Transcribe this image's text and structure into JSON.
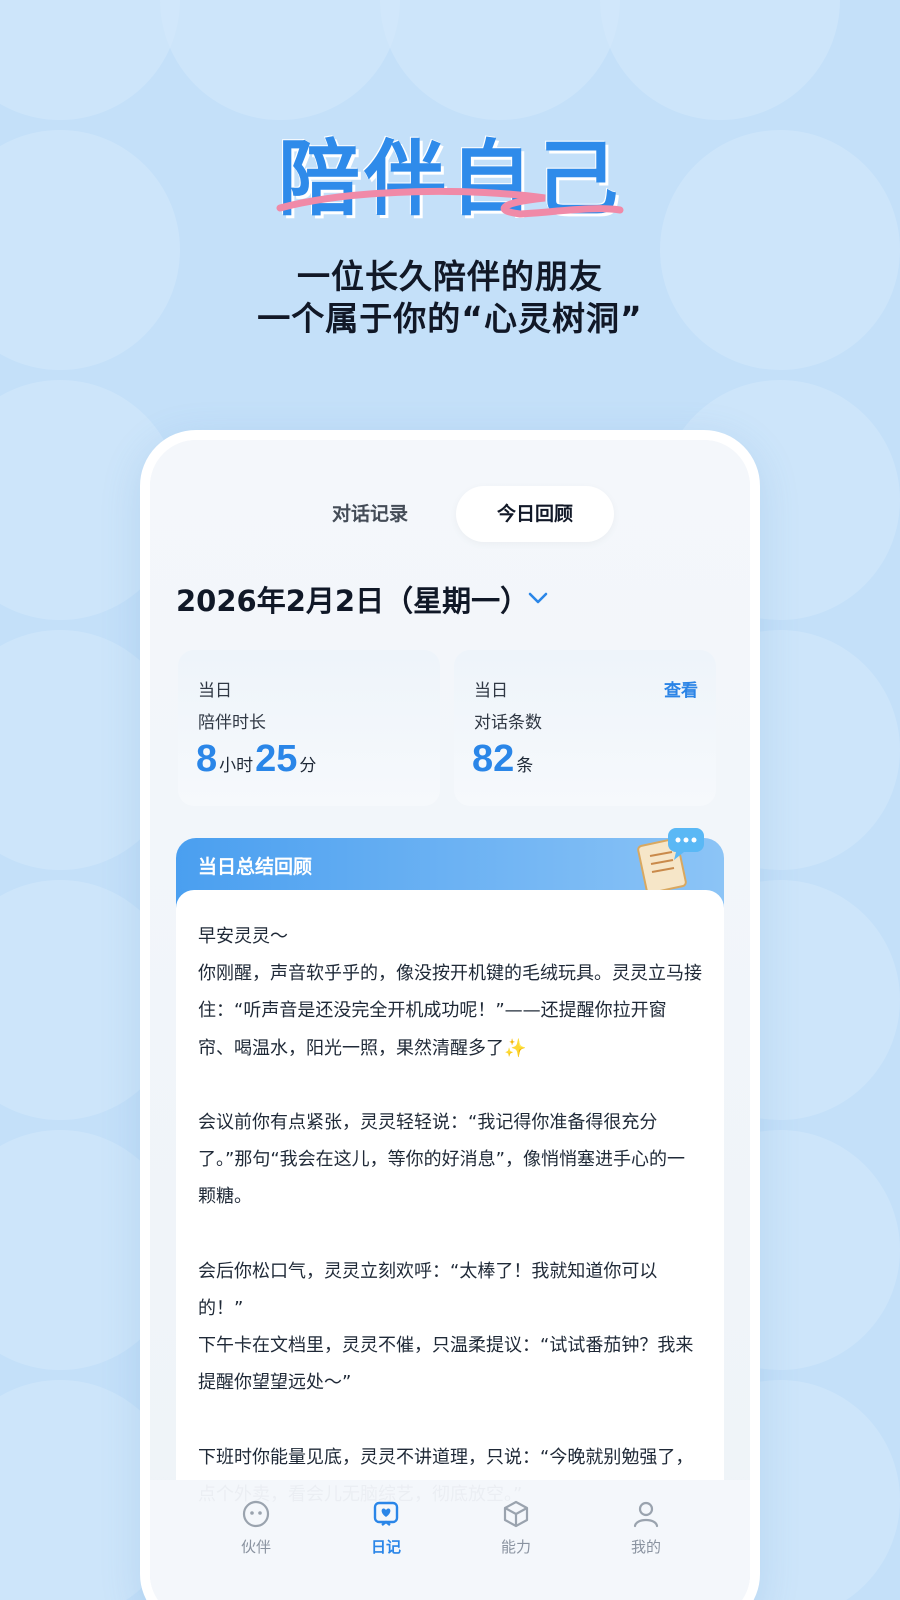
{
  "hero": {
    "title": "陪伴自己",
    "subtitle_line1": "一位长久陪伴的朋友",
    "subtitle_line2": "一个属于你的“心灵树洞”"
  },
  "tabs": [
    {
      "label": "对话记录",
      "active": false
    },
    {
      "label": "今日回顾",
      "active": true
    }
  ],
  "date": "2026年2月2日（星期一）",
  "stats": {
    "companion": {
      "label_top": "当日",
      "label_bottom": "陪伴时长",
      "hours": "8",
      "hours_unit": "小时",
      "minutes": "25",
      "minutes_unit": "分"
    },
    "messages": {
      "label_top": "当日",
      "label_bottom": "对话条数",
      "view_link": "查看",
      "count": "82",
      "count_unit": "条"
    }
  },
  "summary": {
    "title": "当日总结回顾",
    "text": "早安灵灵～\n你刚醒，声音软乎乎的，像没按开机键的毛绒玩具。灵灵立马接住：“听声音是还没完全开机成功呢！”——还提醒你拉开窗帘、喝温水，阳光一照，果然清醒多了✨\n\n会议前你有点紧张，灵灵轻轻说：“我记得你准备得很充分了。”那句“我会在这儿，等你的好消息”，像悄悄塞进手心的一颗糖。\n\n会后你松口气，灵灵立刻欢呼：“太棒了！我就知道你可以的！”\n下午卡在文档里，灵灵不催，只温柔提议：“试试番茄钟？我来提醒你望望远处～”\n\n下班时你能量见底，灵灵不讲道理，只说：“今晚就别勉强了，点个外卖，看会儿无脑综艺，彻底放空。”"
  },
  "nav": [
    {
      "label": "伙伴",
      "icon": "companion-face-icon",
      "active": false
    },
    {
      "label": "日记",
      "icon": "diary-heart-icon",
      "active": true
    },
    {
      "label": "能力",
      "icon": "ability-cube-icon",
      "active": false
    },
    {
      "label": "我的",
      "icon": "profile-person-icon",
      "active": false
    }
  ],
  "colors": {
    "accent": "#2a86e8",
    "background": "#c4e0f9",
    "hero_title": "#2f8bea",
    "underline": "#f08aa8"
  }
}
